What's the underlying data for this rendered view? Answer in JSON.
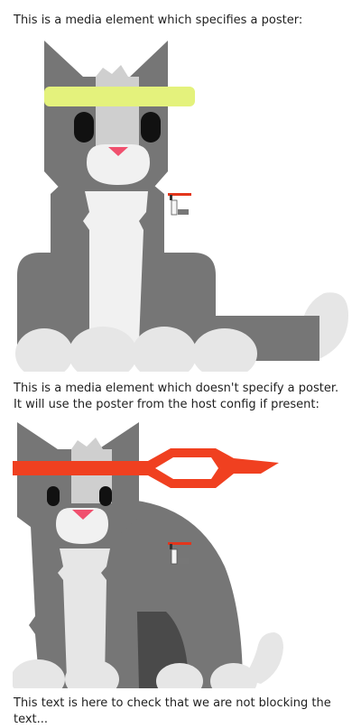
{
  "media1": {
    "caption": "This is a media element which specifies a poster:",
    "poster": "cat-with-yellow-headband",
    "colors": {
      "fur": "#767676",
      "chest": "#f1f1f1",
      "headband": "#e4f27c",
      "nose": "#f0506e"
    }
  },
  "media2": {
    "caption": "This is a media element which doesn't specify a poster. It will use the poster from the host config if present:",
    "poster": "cat-with-red-headband",
    "colors": {
      "fur": "#767676",
      "chest": "#e6e6e6",
      "headband": "#f04020",
      "nose": "#f0506e"
    }
  },
  "footer": {
    "text": "This text is here to check that we are not blocking the text..."
  }
}
